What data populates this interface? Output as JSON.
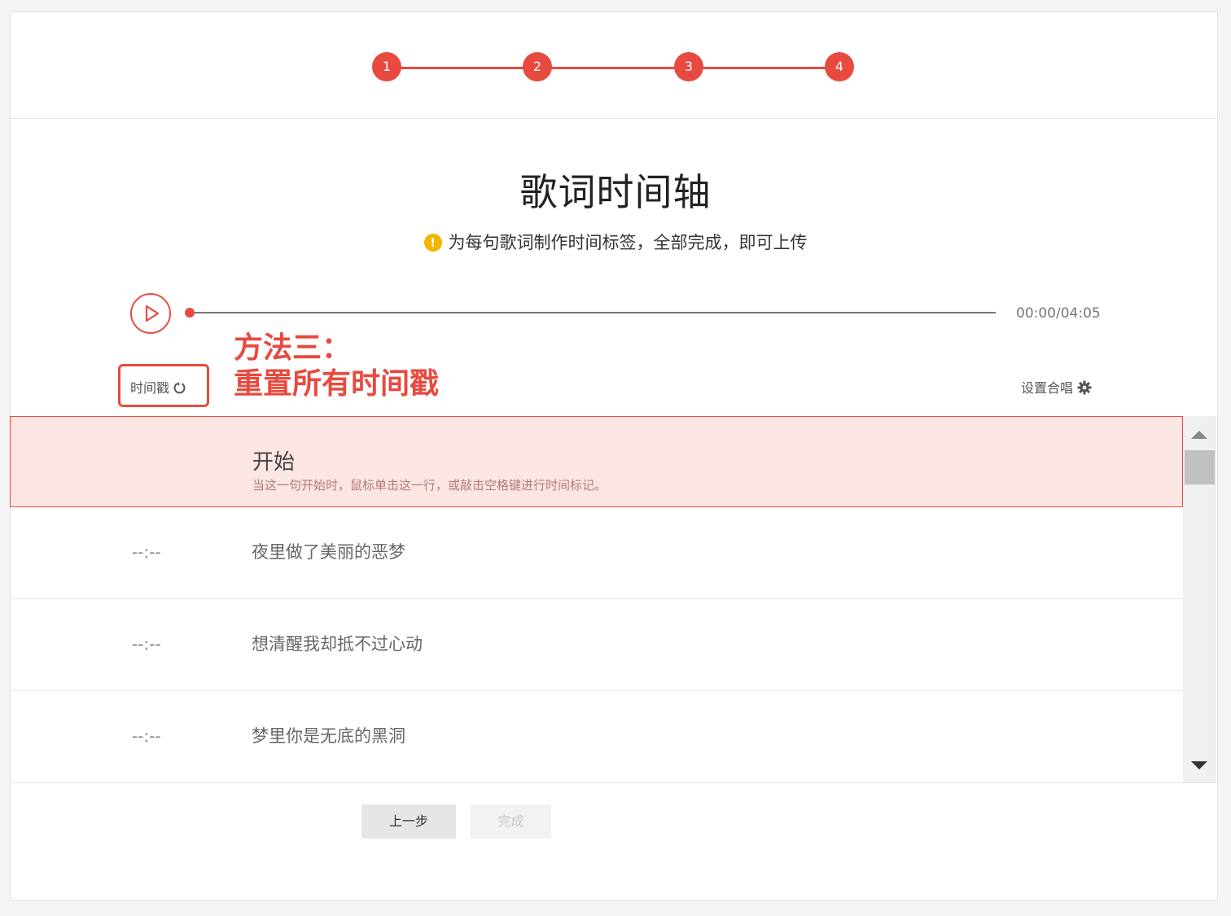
{
  "stepper": {
    "steps": [
      "1",
      "2",
      "3",
      "4"
    ],
    "active_color": "#e84a3f"
  },
  "header": {
    "title": "歌词时间轴",
    "subtitle": "为每句歌词制作时间标签，全部完成，即可上传",
    "warning_icon": "exclamation-circle-icon"
  },
  "player": {
    "time": "00:00/04:05",
    "progress": 0
  },
  "toolbar": {
    "timestamp_label": "时间戳",
    "settings_label": "设置合唱"
  },
  "annotation": {
    "line1": "方法三：",
    "line2": "重置所有时间戳"
  },
  "lyrics": {
    "active": {
      "text": "开始",
      "hint": "当这一句开始时，鼠标单击这一行，或敲击空格键进行时间标记。"
    },
    "rows": [
      {
        "time": "--:--",
        "text": "夜里做了美丽的恶梦"
      },
      {
        "time": "--:--",
        "text": "想清醒我却抵不过心动"
      },
      {
        "time": "--:--",
        "text": "梦里你是无底的黑洞"
      }
    ]
  },
  "footer": {
    "prev_label": "上一步",
    "done_label": "完成"
  }
}
